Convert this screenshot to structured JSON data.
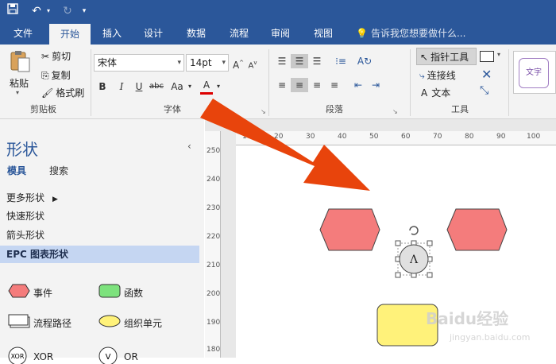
{
  "titlebar": {
    "save_icon": "save-icon",
    "undo_icon": "undo-icon",
    "redo_icon": "redo-icon",
    "customize_icon": "customize-quick-access-icon"
  },
  "tabs": [
    "文件",
    "开始",
    "插入",
    "设计",
    "数据",
    "流程",
    "审阅",
    "视图"
  ],
  "active_tab": "开始",
  "tell_me": "告诉我您想要做什么...",
  "ribbon": {
    "clipboard": {
      "paste": "粘贴",
      "cut": "剪切",
      "copy": "复制",
      "format_painter": "格式刷",
      "label": "剪贴板"
    },
    "font": {
      "family": "宋体",
      "size": "14pt",
      "bold": "B",
      "italic": "I",
      "underline": "U",
      "strike": "abc",
      "case": "Aa",
      "color": "A",
      "label": "字体"
    },
    "paragraph": {
      "label": "段落"
    },
    "tools": {
      "pointer": "指针工具",
      "connector": "连接线",
      "text": "文本",
      "label": "工具"
    },
    "style_preview": "文字"
  },
  "pane": {
    "title": "形状",
    "tabs": [
      "模具",
      "搜索"
    ],
    "more_shapes": "更多形状",
    "stencils": [
      "快速形状",
      "箭头形状",
      "EPC 图表形状"
    ],
    "selected_stencil": "EPC 图表形状",
    "shapes": [
      {
        "label": "事件",
        "color": "#f47c7c"
      },
      {
        "label": "函数",
        "color": "#7de27d"
      },
      {
        "label": "流程路径",
        "color": "#ffffff"
      },
      {
        "label": "组织单元",
        "color": "#fff27a"
      },
      {
        "label": "XOR",
        "color": "#ffffff"
      },
      {
        "label": "OR",
        "color": "#ffffff"
      }
    ]
  },
  "ruler": {
    "h_ticks": [
      "10",
      "20",
      "30",
      "40",
      "50",
      "60",
      "70",
      "80",
      "90",
      "100"
    ],
    "v_ticks": [
      "250",
      "240",
      "230",
      "220",
      "210",
      "200",
      "190",
      "180"
    ]
  },
  "canvas": {
    "and_symbol": "Λ",
    "colors": {
      "event": "#f47c7c",
      "org_unit": "#fff27a",
      "arrow": "#e8440c",
      "selected": "#e0e0e0"
    }
  },
  "watermark": {
    "brand": "Baidu经验",
    "url": "jingyan.baidu.com"
  }
}
